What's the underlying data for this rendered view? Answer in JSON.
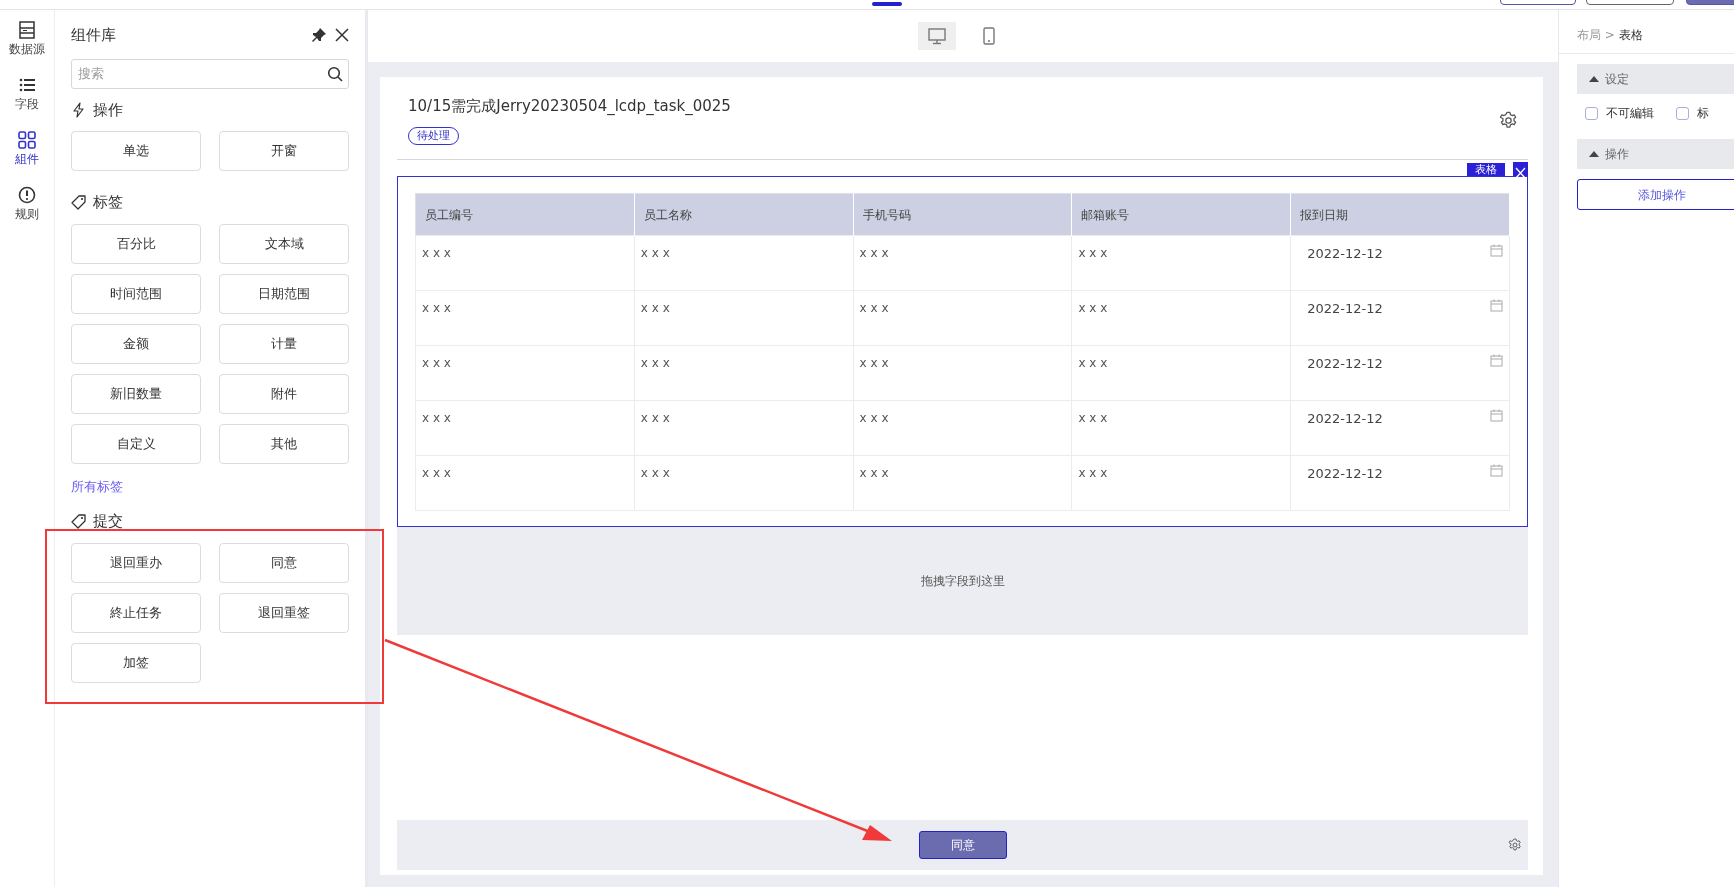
{
  "rail": [
    {
      "label": "数据源",
      "kind": "datasource",
      "selected": false
    },
    {
      "label": "字段",
      "kind": "fields",
      "selected": false
    },
    {
      "label": "組件",
      "kind": "components",
      "selected": true
    },
    {
      "label": "规则",
      "kind": "rules",
      "selected": false
    }
  ],
  "library": {
    "title": "组件库",
    "search": {
      "placeholder": "搜索"
    },
    "sections": [
      {
        "title": "操作",
        "kind": "bolt",
        "items": [
          "单选",
          "开窗"
        ]
      },
      {
        "title": "标签",
        "kind": "tag",
        "items": [
          "百分比",
          "文本域",
          "时间范围",
          "日期范围",
          "金额",
          "计量",
          "新旧数量",
          "附件",
          "自定义",
          "其他"
        ],
        "link": "所有标签"
      },
      {
        "title": "提交",
        "kind": "tag",
        "items": [
          "退回重办",
          "同意",
          "終止任务",
          "退回重签",
          "加签"
        ]
      }
    ]
  },
  "device_tabs": [
    {
      "kind": "desktop",
      "selected": true
    },
    {
      "kind": "mobile",
      "selected": false
    }
  ],
  "form": {
    "title": "10/15需完成Jerry20230504_lcdp_task_0025",
    "status": "待处理",
    "table": {
      "tag": "表格",
      "columns": [
        "员工编号",
        "员工名称",
        "手机号码",
        "邮箱账号",
        "报到日期"
      ],
      "rows": [
        [
          "x x x",
          "x x x",
          "x x x",
          "x x x",
          "2022-12-12"
        ],
        [
          "x x x",
          "x x x",
          "x x x",
          "x x x",
          "2022-12-12"
        ],
        [
          "x x x",
          "x x x",
          "x x x",
          "x x x",
          "2022-12-12"
        ],
        [
          "x x x",
          "x x x",
          "x x x",
          "x x x",
          "2022-12-12"
        ],
        [
          "x x x",
          "x x x",
          "x x x",
          "x x x",
          "2022-12-12"
        ]
      ]
    },
    "dropzone": "拖拽字段到这里",
    "submit": "同意"
  },
  "properties": {
    "breadcrumb": {
      "parent": "布局",
      "separator": ">",
      "current": "表格"
    },
    "sections": [
      {
        "title": "设定",
        "expanded": true,
        "options": [
          {
            "label": "不可編辑",
            "checked": false
          },
          {
            "label": "标",
            "checked": false
          }
        ]
      },
      {
        "title": "操作",
        "expanded": true,
        "button": "添加操作"
      }
    ]
  }
}
